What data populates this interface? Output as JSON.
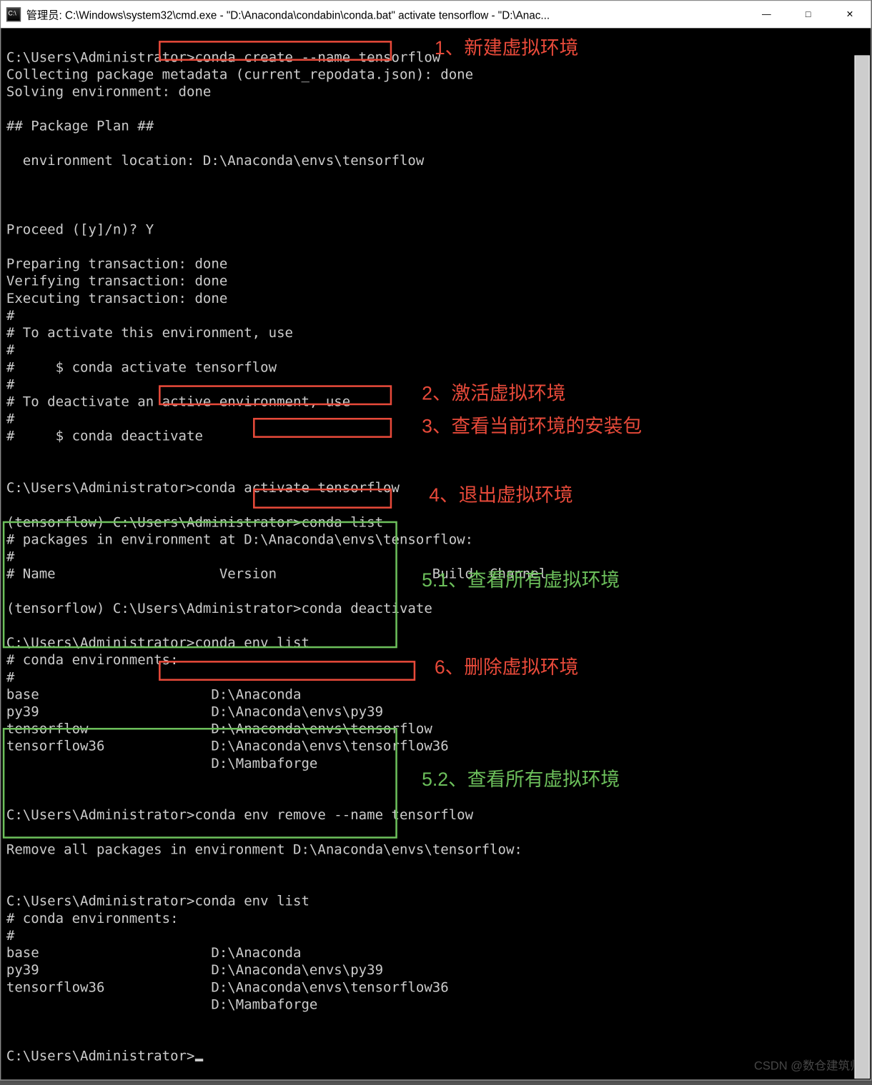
{
  "window": {
    "title": "管理员: C:\\Windows\\system32\\cmd.exe - \"D:\\Anaconda\\condabin\\conda.bat\"  activate tensorflow - \"D:\\Anac...",
    "icon_label": "C:\\",
    "buttons": {
      "min": "—",
      "max": "□",
      "close": "✕"
    }
  },
  "terminal": {
    "body": "\nC:\\Users\\Administrator>conda create --name tensorflow\nCollecting package metadata (current_repodata.json): done\nSolving environment: done\n\n## Package Plan ##\n\n  environment location: D:\\Anaconda\\envs\\tensorflow\n\n\n\nProceed ([y]/n)? Y\n\nPreparing transaction: done\nVerifying transaction: done\nExecuting transaction: done\n#\n# To activate this environment, use\n#\n#     $ conda activate tensorflow\n#\n# To deactivate an active environment, use\n#\n#     $ conda deactivate\n\n\nC:\\Users\\Administrator>conda activate tensorflow\n\n(tensorflow) C:\\Users\\Administrator>conda list\n# packages in environment at D:\\Anaconda\\envs\\tensorflow:\n#\n# Name                    Version                   Build  Channel\n\n(tensorflow) C:\\Users\\Administrator>conda deactivate\n\nC:\\Users\\Administrator>conda env list\n# conda environments:\n#\nbase                     D:\\Anaconda\npy39                     D:\\Anaconda\\envs\\py39\ntensorflow               D:\\Anaconda\\envs\\tensorflow\ntensorflow36             D:\\Anaconda\\envs\\tensorflow36\n                         D:\\Mambaforge\n\n\nC:\\Users\\Administrator>conda env remove --name tensorflow\n\nRemove all packages in environment D:\\Anaconda\\envs\\tensorflow:\n\n\nC:\\Users\\Administrator>conda env list\n# conda environments:\n#\nbase                     D:\\Anaconda\npy39                     D:\\Anaconda\\envs\\py39\ntensorflow36             D:\\Anaconda\\envs\\tensorflow36\n                         D:\\Mambaforge\n\n\nC:\\Users\\Administrator>"
  },
  "annotations": {
    "a1": "1、新建虚拟环境",
    "a2": "2、激活虚拟环境",
    "a3": "3、查看当前环境的安装包",
    "a4": "4、退出虚拟环境",
    "a51": "5.1、查看所有虚拟环境",
    "a6": "6、删除虚拟环境",
    "a52": "5.2、查看所有虚拟环境"
  },
  "watermark": "CSDN @数仓建筑师"
}
